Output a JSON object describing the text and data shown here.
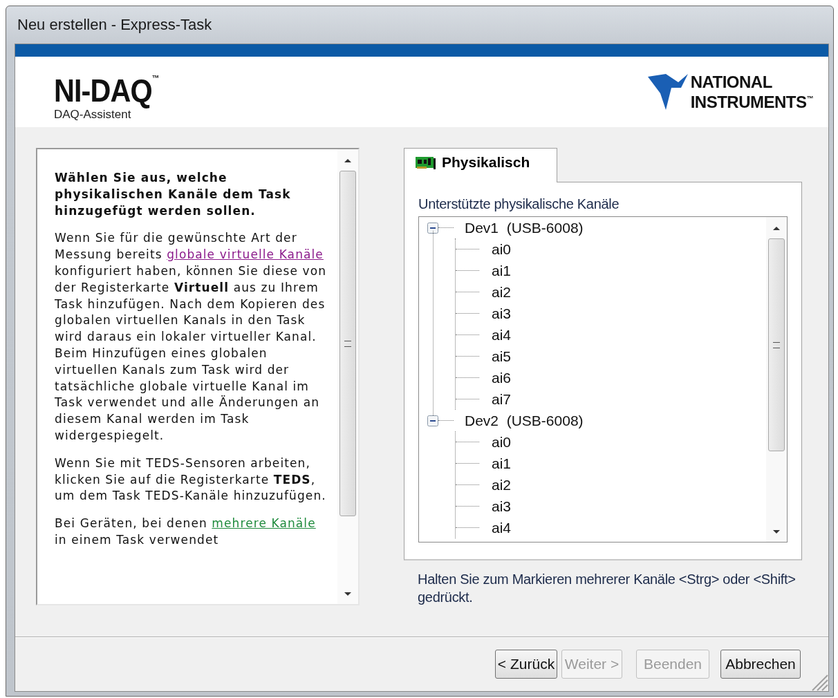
{
  "window": {
    "title": "Neu erstellen - Express-Task"
  },
  "header": {
    "product": "NI-DAQ$^{™}$",
    "subtitle": "DAQ-Assistent",
    "brand_lines": [
      "NATIONAL",
      "INSTRUMENTS$^{™}$"
    ]
  },
  "help": {
    "paragraphs": [
      {
        "kind": "heading",
        "parts": [
          {
            "kind": "text",
            "text": "Wählen Sie aus, welche physikalischen Kanäle dem Task hinzugefügt werden sollen."
          }
        ]
      },
      {
        "kind": "body",
        "parts": [
          {
            "kind": "text",
            "text": "Wenn Sie für die gewünschte Art der Messung bereits"
          },
          {
            "kind": "link",
            "text": "globale virtuelle Kanäle",
            "color": "#8b1a8b"
          },
          {
            "kind": "text",
            "text": "konfiguriert haben, können Sie diese von der Registerkarte **Virtuell** aus zu Ihrem Task hinzufügen. Nach dem Kopieren des globalen virtuellen Kanals in den Task wird daraus ein lokaler virtueller Kanal. Beim Hinzufügen eines globalen virtuellen Kanals zum Task wird der tatsächliche globale virtuelle Kanal im Task verwendet und alle Änderungen an diesem Kanal werden im Task widergespiegelt."
          }
        ]
      },
      {
        "kind": "body",
        "parts": [
          {
            "kind": "text",
            "text": "Wenn Sie mit TEDS-Sensoren arbeiten, klicken Sie auf die Registerkarte **TEDS**, um dem Task TEDS-Kanäle hinzuzufügen."
          }
        ]
      },
      {
        "kind": "body",
        "parts": [
          {
            "kind": "text",
            "text": "Bei Geräten, bei denen"
          },
          {
            "kind": "link",
            "text": "mehrere Kanäle",
            "color": "#1e8a3c"
          },
          {
            "kind": "text",
            "text": "in einem Task verwendet"
          }
        ]
      }
    ]
  },
  "tabs": [
    {
      "label": "Physikalisch",
      "selected": true
    }
  ],
  "channels": {
    "label": "Unterstützte physikalische Kanäle",
    "devices": [
      {
        "name": "Dev1  (USB-6008)",
        "expanded": true,
        "children": [
          "ai0",
          "ai1",
          "ai2",
          "ai3",
          "ai4",
          "ai5",
          "ai6",
          "ai7"
        ]
      },
      {
        "name": "Dev2  (USB-6008)",
        "expanded": true,
        "children": [
          "ai0",
          "ai1",
          "ai2",
          "ai3",
          "ai4"
        ]
      }
    ]
  },
  "hint": "Halten Sie zum Markieren mehrerer Kanäle <Strg> oder <Shift> gedrückt.",
  "buttons": [
    {
      "label": "< Zurück",
      "disabled": false
    },
    {
      "label": "Weiter >",
      "disabled": true
    },
    {
      "label": "Beenden",
      "disabled": true
    },
    {
      "label": "Abbrechen",
      "disabled": false
    }
  ]
}
